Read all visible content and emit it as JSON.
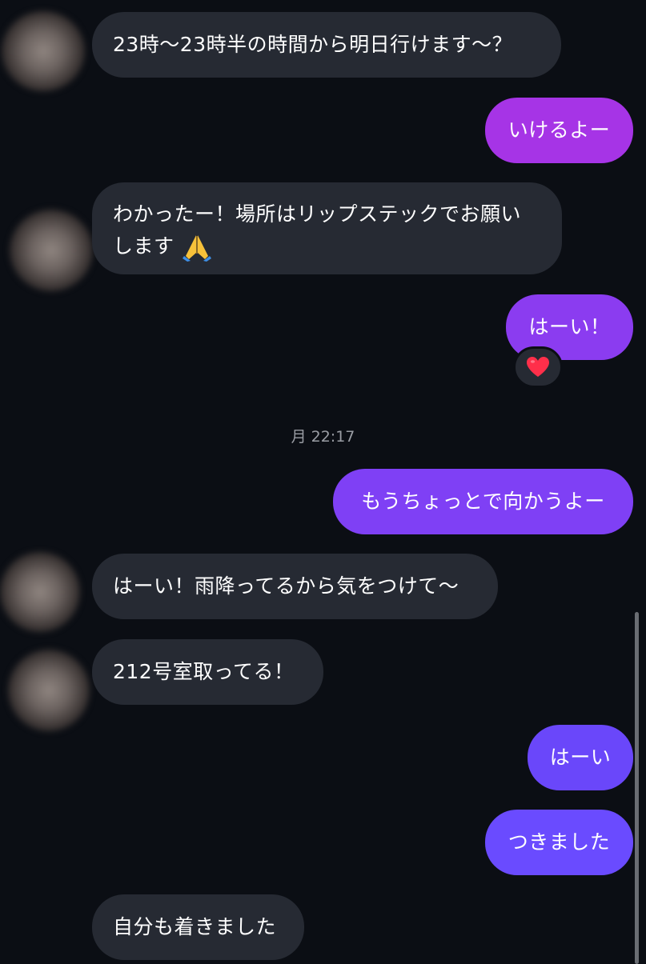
{
  "colors": {
    "background": "#0b0e14",
    "incoming_bubble": "#262a33",
    "outgoing_gradient_top": "#a33be6",
    "outgoing_gradient_bottom": "#6a4bff",
    "timestamp_text": "#9a9da4"
  },
  "messages": [
    {
      "id": "m1",
      "direction": "in",
      "text": "23時〜23時半の時間から明日行けます〜？"
    },
    {
      "id": "m2",
      "direction": "out",
      "text": "いけるよー"
    },
    {
      "id": "m3",
      "direction": "in",
      "text_line1": "わかったー！場所はリップステックでお願い",
      "text_line2": "します",
      "emoji": "folded-hands-icon"
    },
    {
      "id": "m4",
      "direction": "out",
      "text": "はーい！",
      "reaction": "heart-icon"
    },
    {
      "id": "m5",
      "direction": "out",
      "text": "もうちょっとで向かうよー"
    },
    {
      "id": "m6",
      "direction": "in",
      "text": "はーい！雨降ってるから気をつけて〜"
    },
    {
      "id": "m7",
      "direction": "in",
      "text": "212号室取ってる！"
    },
    {
      "id": "m8",
      "direction": "out",
      "text": "はーい"
    },
    {
      "id": "m9",
      "direction": "out",
      "text": "つきました"
    },
    {
      "id": "m10",
      "direction": "in",
      "text": "自分も着きました"
    }
  ],
  "timestamp": "月 22:17"
}
